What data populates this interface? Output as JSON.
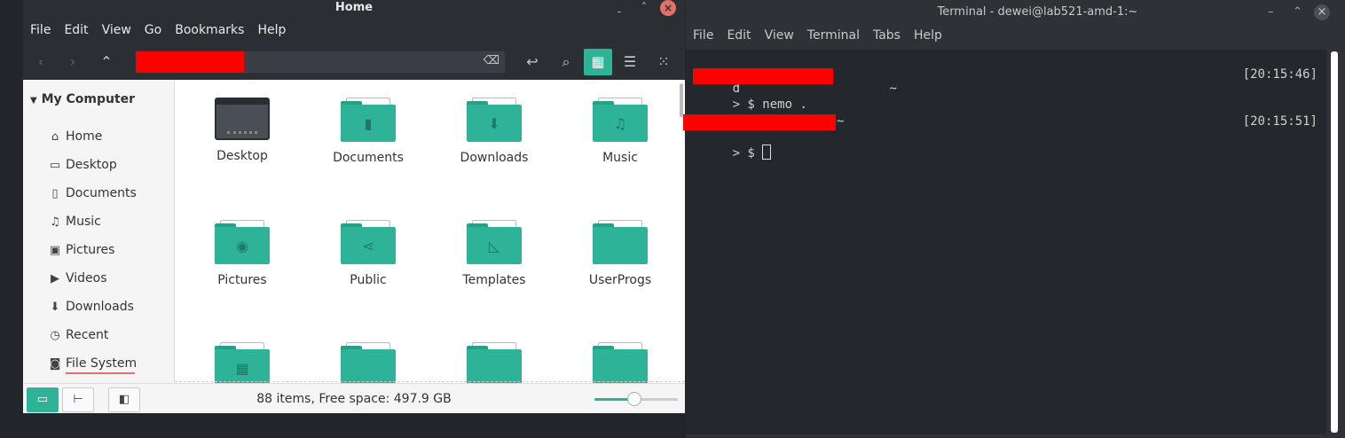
{
  "nemo": {
    "title": "Home",
    "window_buttons": {
      "minimize": "ˍ",
      "maximize": "˄",
      "close": "×"
    },
    "menu": [
      "File",
      "Edit",
      "View",
      "Go",
      "Bookmarks",
      "Help"
    ],
    "toolbar": {
      "back_icon": "chevron-left-icon",
      "forward_icon": "chevron-right-icon",
      "up_icon": "chevron-up-icon",
      "location_value": "",
      "redacted": true
    },
    "sidebar": {
      "header": "My Computer",
      "items": [
        {
          "label": "Home",
          "icon": "⌂"
        },
        {
          "label": "Desktop",
          "icon": "▭"
        },
        {
          "label": "Documents",
          "icon": "▯"
        },
        {
          "label": "Music",
          "icon": "♫"
        },
        {
          "label": "Pictures",
          "icon": "▣"
        },
        {
          "label": "Videos",
          "icon": "▶"
        },
        {
          "label": "Downloads",
          "icon": "⬇"
        },
        {
          "label": "Recent",
          "icon": "◷"
        },
        {
          "label": "File System",
          "icon": "◙"
        }
      ]
    },
    "files": [
      {
        "label": "Desktop",
        "kind": "desktop",
        "emblem": ""
      },
      {
        "label": "Documents",
        "kind": "folder",
        "emblem": "▮"
      },
      {
        "label": "Downloads",
        "kind": "folder",
        "emblem": "⬇"
      },
      {
        "label": "Music",
        "kind": "folder",
        "emblem": "♫"
      },
      {
        "label": "Pictures",
        "kind": "folder",
        "emblem": "◉"
      },
      {
        "label": "Public",
        "kind": "folder",
        "emblem": "⋖"
      },
      {
        "label": "Templates",
        "kind": "folder",
        "emblem": "◺"
      },
      {
        "label": "UserProgs",
        "kind": "folder",
        "emblem": ""
      },
      {
        "label": "",
        "kind": "folder",
        "emblem": "▦"
      },
      {
        "label": "",
        "kind": "folder",
        "emblem": ""
      },
      {
        "label": "",
        "kind": "folder",
        "emblem": ""
      },
      {
        "label": "",
        "kind": "folder",
        "emblem": ""
      }
    ],
    "status": {
      "text": "88 items, Free space: 497.9 GB",
      "zoom_fraction": 0.48
    },
    "colors": {
      "accent": "#2eb398",
      "close": "#e0726a"
    }
  },
  "terminal": {
    "title": "Terminal - dewei@lab521-amd-1:~",
    "menu": [
      "File",
      "Edit",
      "View",
      "Terminal",
      "Tabs",
      "Help"
    ],
    "lines": [
      {
        "prefix": "d",
        "tail": " ~",
        "timestamp": "[20:15:46]"
      },
      {
        "prompt": "> $ ",
        "command": "nemo ."
      },
      {
        "prefix": "",
        "tail": "~",
        "timestamp": "[20:15:51]"
      },
      {
        "prompt": "> $ ",
        "command": ""
      }
    ]
  }
}
